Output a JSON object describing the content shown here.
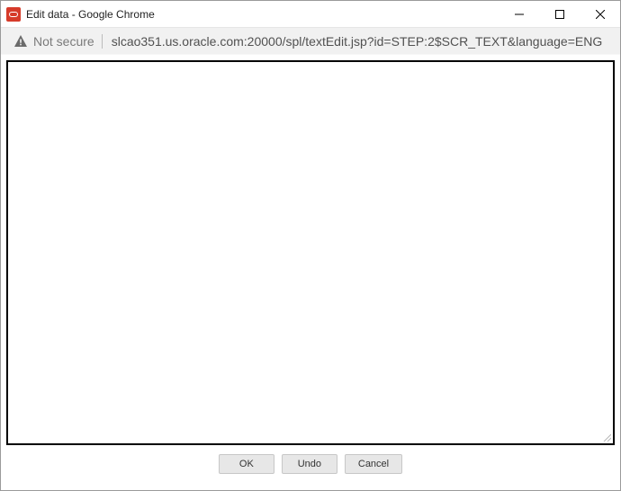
{
  "window": {
    "title": "Edit data - Google Chrome"
  },
  "urlbar": {
    "security_label": "Not secure",
    "url": "slcao351.us.oracle.com:20000/spl/textEdit.jsp?id=STEP:2$SCR_TEXT&language=ENG"
  },
  "editor": {
    "value": ""
  },
  "buttons": {
    "ok": "OK",
    "undo": "Undo",
    "cancel": "Cancel"
  }
}
